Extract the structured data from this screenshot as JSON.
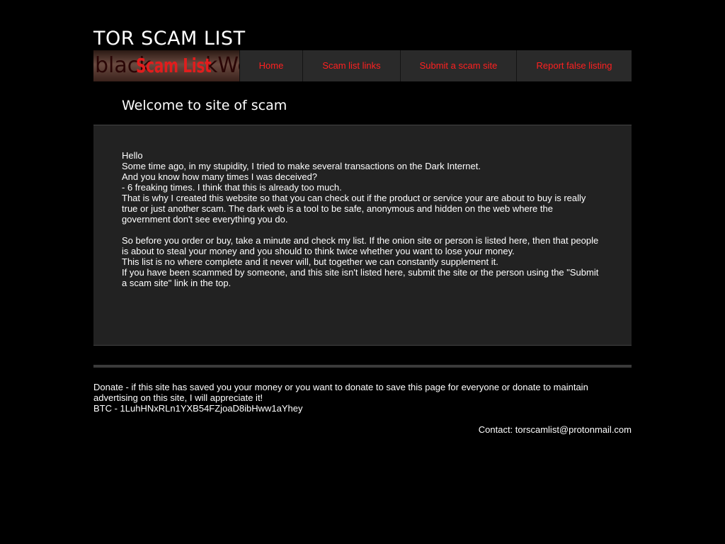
{
  "site": {
    "title": "TOR SCAM LIST",
    "logo": {
      "main_text": "Scam List",
      "bg_left_text": "black",
      "bg_right_text": "kWe"
    }
  },
  "nav": {
    "items": [
      {
        "label": "Home"
      },
      {
        "label": "Scam list links"
      },
      {
        "label": "Submit a scam site"
      },
      {
        "label": "Report false listing"
      }
    ],
    "link_color": "#ff2020"
  },
  "main": {
    "heading": "Welcome to site of scam",
    "paragraphs": [
      "Hello",
      "Some time ago, in my stupidity, I tried to make several transactions on the Dark Internet.",
      "And you know how many times I was deceived?",
      "- 6 freaking times. I think that this is already too much.",
      "That is why I created this website so that you can check out if the product or service your are about to buy is really true or just another scam. The dark web is a tool to be safe, anonymous and hidden on the web where the government don't see everything you do.",
      "So before you order or buy, take a minute and check my list. If the onion site or person is listed here, then that people is about to steal your money and you should to think twice whether you want to lose your money.",
      "This list is no where complete and it never will, but together we can constantly supplement it.",
      "If you have been scammed by someone, and this site isn't listed here, submit the site or the person using the \"Submit a scam site\" link in the top."
    ]
  },
  "footer": {
    "donate_text": "Donate - if this site has saved you your money or you want to donate to save this page for everyone or donate to maintain advertising on this site, I will appreciate it!",
    "btc_text": "BTC - 1LuhHNxRLn1YXB54FZjoaD8ibHww1aYhey",
    "contact_text": "Contact: torscamlist@protonmail.com"
  }
}
